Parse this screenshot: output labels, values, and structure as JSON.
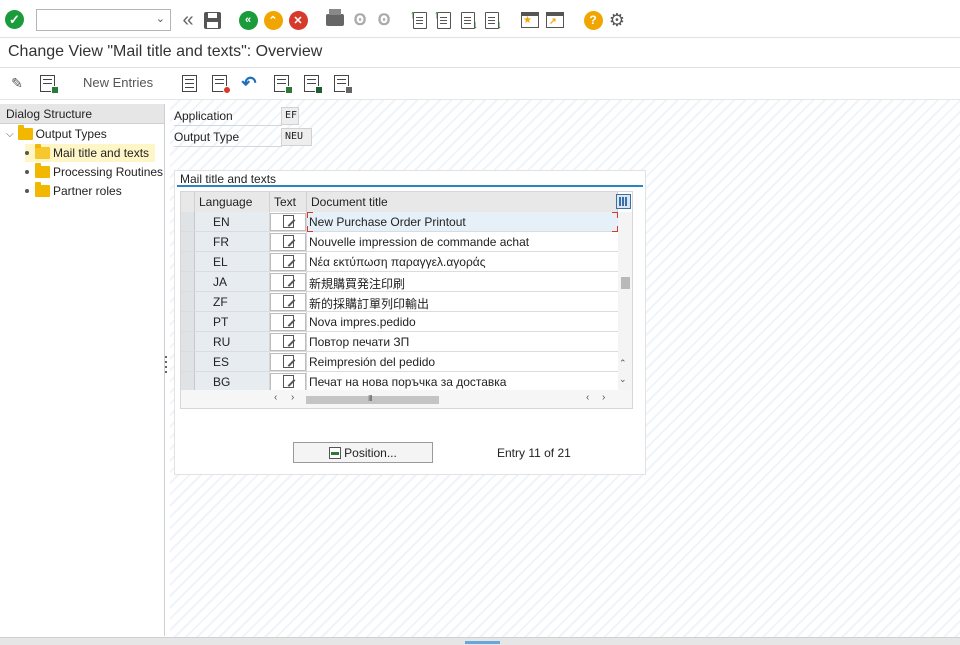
{
  "toolbar": {
    "command_field_value": "",
    "icons": [
      "enter-icon",
      "back-double-icon",
      "save-icon",
      "back-icon",
      "exit-icon",
      "cancel-icon",
      "print-icon",
      "find-icon",
      "find-next-icon",
      "first-page-icon",
      "previous-page-icon",
      "next-page-icon",
      "last-page-icon",
      "create-session-icon",
      "shortcut-icon",
      "help-icon",
      "customize-layout-icon"
    ]
  },
  "title": "Change View \"Mail title and texts\": Overview",
  "app_toolbar": {
    "new_entries_label": "New Entries"
  },
  "dialog_structure": {
    "header": "Dialog Structure",
    "root": "Output Types",
    "items": [
      "Mail title and texts",
      "Processing Routines",
      "Partner roles"
    ],
    "selected": "Mail title and texts"
  },
  "fields": {
    "application_label": "Application",
    "application_value": "EF",
    "output_type_label": "Output Type",
    "output_type_value": "NEU"
  },
  "group": {
    "title": "Mail title and texts"
  },
  "table": {
    "columns": [
      "Language",
      "Text",
      "Document title"
    ],
    "rows": [
      {
        "language": "EN",
        "title": "New Purchase Order Printout"
      },
      {
        "language": "FR",
        "title": "Nouvelle impression de commande achat"
      },
      {
        "language": "EL",
        "title": "Νέα εκτύπωση παραγγελ.αγοράς"
      },
      {
        "language": "JA",
        "title": "新規購買発注印刷"
      },
      {
        "language": "ZF",
        "title": "新的採購訂單列印輸出"
      },
      {
        "language": "PT",
        "title": "Nova impres.pedido"
      },
      {
        "language": "RU",
        "title": "Повтор печати ЗП"
      },
      {
        "language": "ES",
        "title": "Reimpresión del pedido"
      },
      {
        "language": "BG",
        "title": "Печат на нова поръчка за доставка"
      }
    ]
  },
  "footer": {
    "position_label": "Position...",
    "entry_text": "Entry 11 of 21"
  }
}
